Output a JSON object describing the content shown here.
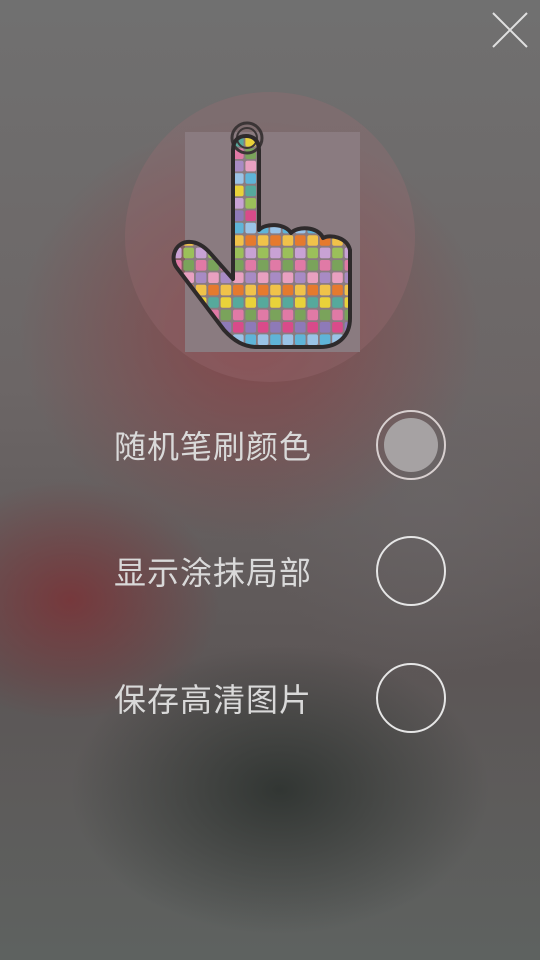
{
  "close_button": {
    "icon": "close-icon",
    "color": "#e0e0e0"
  },
  "hero": {
    "icon": "pointing-hand-mosaic-icon"
  },
  "options": [
    {
      "label": "随机笔刷颜色",
      "checked": true
    },
    {
      "label": "显示涂抹局部",
      "checked": false
    },
    {
      "label": "保存高清图片",
      "checked": false
    }
  ]
}
